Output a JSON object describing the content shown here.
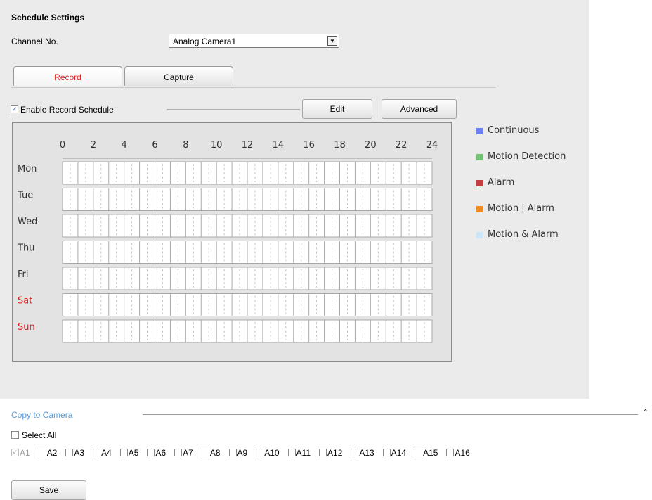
{
  "section_title": "Schedule Settings",
  "channel": {
    "label": "Channel No.",
    "selected": "Analog Camera1",
    "arrow_icon": "chevron-down-icon"
  },
  "tabs": [
    {
      "label": "Record",
      "active": true
    },
    {
      "label": "Capture",
      "active": false
    }
  ],
  "record": {
    "enable_label": "Enable Record Schedule",
    "enable_checked": true,
    "edit_label": "Edit",
    "advanced_label": "Advanced"
  },
  "schedule": {
    "hour_labels": [
      "0",
      "2",
      "4",
      "6",
      "8",
      "10",
      "12",
      "14",
      "16",
      "18",
      "20",
      "22",
      "24"
    ],
    "days": [
      {
        "label": "Mon",
        "weekend": false
      },
      {
        "label": "Tue",
        "weekend": false
      },
      {
        "label": "Wed",
        "weekend": false
      },
      {
        "label": "Thu",
        "weekend": false
      },
      {
        "label": "Fri",
        "weekend": false
      },
      {
        "label": "Sat",
        "weekend": true
      },
      {
        "label": "Sun",
        "weekend": true
      }
    ],
    "weekend_color": "#e02020"
  },
  "legend": [
    {
      "label": "Continuous",
      "color": "#6b7ff2"
    },
    {
      "label": "Motion Detection",
      "color": "#74c276"
    },
    {
      "label": "Alarm",
      "color": "#c44040"
    },
    {
      "label": "Motion | Alarm",
      "color": "#f08a1c"
    },
    {
      "label": "Motion & Alarm",
      "color": "#cde6f7"
    }
  ],
  "copy": {
    "title": "Copy to Camera",
    "collapse_icon": "double-chevron-up-icon",
    "select_all_label": "Select All",
    "cameras": [
      {
        "label": "A1",
        "checked": true,
        "disabled": true
      },
      {
        "label": "A2",
        "checked": false,
        "disabled": false
      },
      {
        "label": "A3",
        "checked": false,
        "disabled": false
      },
      {
        "label": "A4",
        "checked": false,
        "disabled": false
      },
      {
        "label": "A5",
        "checked": false,
        "disabled": false
      },
      {
        "label": "A6",
        "checked": false,
        "disabled": false
      },
      {
        "label": "A7",
        "checked": false,
        "disabled": false
      },
      {
        "label": "A8",
        "checked": false,
        "disabled": false
      },
      {
        "label": "A9",
        "checked": false,
        "disabled": false
      },
      {
        "label": "A10",
        "checked": false,
        "disabled": false
      },
      {
        "label": "A11",
        "checked": false,
        "disabled": false
      },
      {
        "label": "A12",
        "checked": false,
        "disabled": false
      },
      {
        "label": "A13",
        "checked": false,
        "disabled": false
      },
      {
        "label": "A14",
        "checked": false,
        "disabled": false
      },
      {
        "label": "A15",
        "checked": false,
        "disabled": false
      },
      {
        "label": "A16",
        "checked": false,
        "disabled": false
      }
    ]
  },
  "save_label": "Save"
}
